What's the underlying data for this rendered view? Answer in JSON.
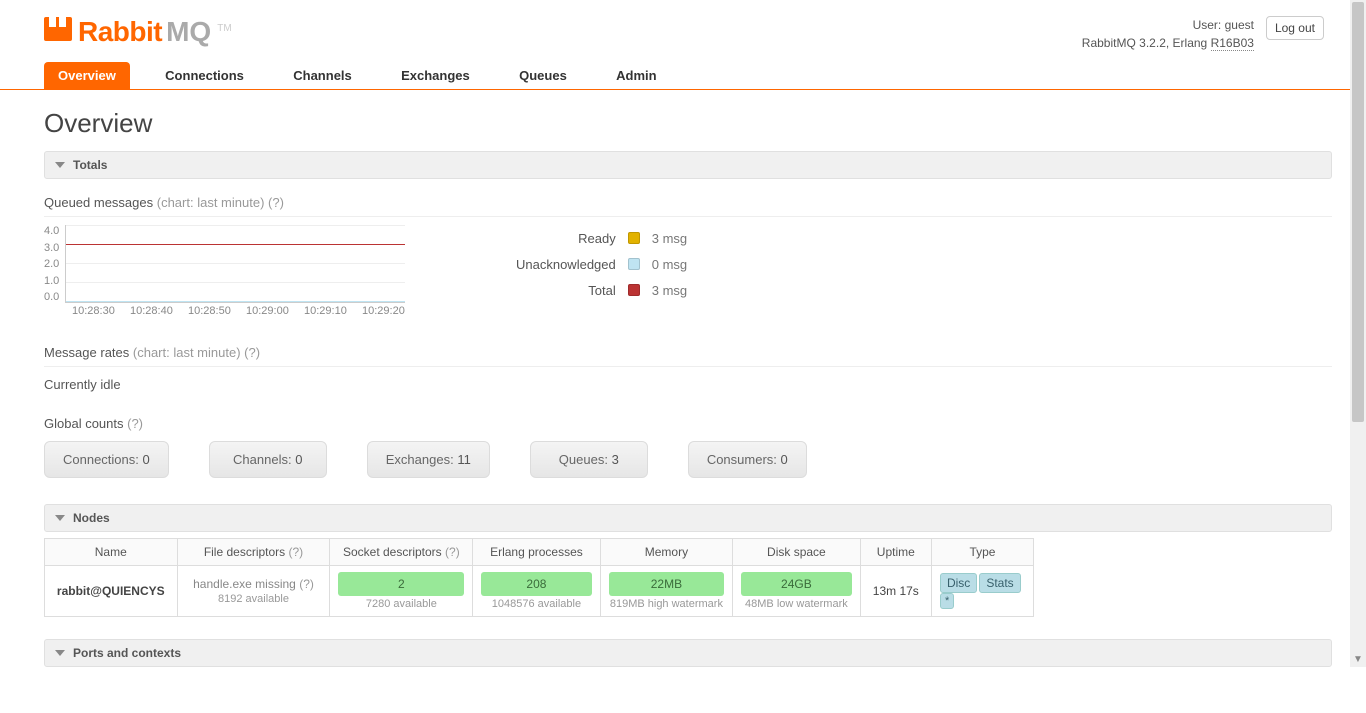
{
  "header": {
    "logo_text": "Rabbit",
    "logo_suffix": "MQ",
    "tm": "TM",
    "user_label": "User:",
    "user": "guest",
    "version_prefix": "RabbitMQ",
    "version": "3.2.2,",
    "erlang_label": "Erlang",
    "erlang_version": "R16B03",
    "logout": "Log out"
  },
  "tabs": [
    "Overview",
    "Connections",
    "Channels",
    "Exchanges",
    "Queues",
    "Admin"
  ],
  "page_title": "Overview",
  "sections": {
    "totals": "Totals",
    "nodes": "Nodes",
    "ports": "Ports and contexts"
  },
  "queued": {
    "title": "Queued messages",
    "hint": "(chart: last minute)",
    "help": "(?)"
  },
  "chart_data": {
    "type": "line",
    "title": "Queued messages (last minute)",
    "xlabel": "",
    "ylabel": "",
    "ylim": [
      0,
      4
    ],
    "y_ticks": [
      "4.0",
      "3.0",
      "2.0",
      "1.0",
      "0.0"
    ],
    "x_ticks": [
      "10:28:30",
      "10:28:40",
      "10:28:50",
      "10:29:00",
      "10:29:10",
      "10:29:20"
    ],
    "series": [
      {
        "name": "Ready",
        "color": "#e2b200",
        "values": [
          3,
          3,
          3,
          3,
          3,
          3
        ]
      },
      {
        "name": "Unacknowledged",
        "color": "#bfe4f2",
        "values": [
          0,
          0,
          0,
          0,
          0,
          0
        ]
      },
      {
        "name": "Total",
        "color": "#b33",
        "values": [
          3,
          3,
          3,
          3,
          3,
          3
        ]
      }
    ]
  },
  "legend": [
    {
      "label": "Ready",
      "color": "#e2b200",
      "value": "3 msg"
    },
    {
      "label": "Unacknowledged",
      "color": "#bfe4f2",
      "value": "0 msg"
    },
    {
      "label": "Total",
      "color": "#b33",
      "value": "3 msg"
    }
  ],
  "rates": {
    "title": "Message rates",
    "hint": "(chart: last minute)",
    "help": "(?)",
    "idle": "Currently idle"
  },
  "global_counts": {
    "title": "Global counts",
    "help": "(?)",
    "items": [
      {
        "label": "Connections:",
        "value": "0"
      },
      {
        "label": "Channels:",
        "value": "0"
      },
      {
        "label": "Exchanges:",
        "value": "11"
      },
      {
        "label": "Queues:",
        "value": "3"
      },
      {
        "label": "Consumers:",
        "value": "0"
      }
    ]
  },
  "nodes_table": {
    "headers": [
      "Name",
      "File descriptors",
      "Socket descriptors",
      "Erlang processes",
      "Memory",
      "Disk space",
      "Uptime",
      "Type"
    ],
    "help": "(?)",
    "row": {
      "name": "rabbit@QUIENCYS",
      "fd_main": "handle.exe missing",
      "fd_help": "(?)",
      "fd_sub": "8192 available",
      "sock_main": "2",
      "sock_sub": "7280 available",
      "erl_main": "208",
      "erl_sub": "1048576 available",
      "mem_main": "22MB",
      "mem_sub": "819MB high watermark",
      "disk_main": "24GB",
      "disk_sub": "48MB low watermark",
      "uptime": "13m 17s",
      "type_disc": "Disc",
      "type_stats": "Stats",
      "type_star": "*"
    }
  }
}
